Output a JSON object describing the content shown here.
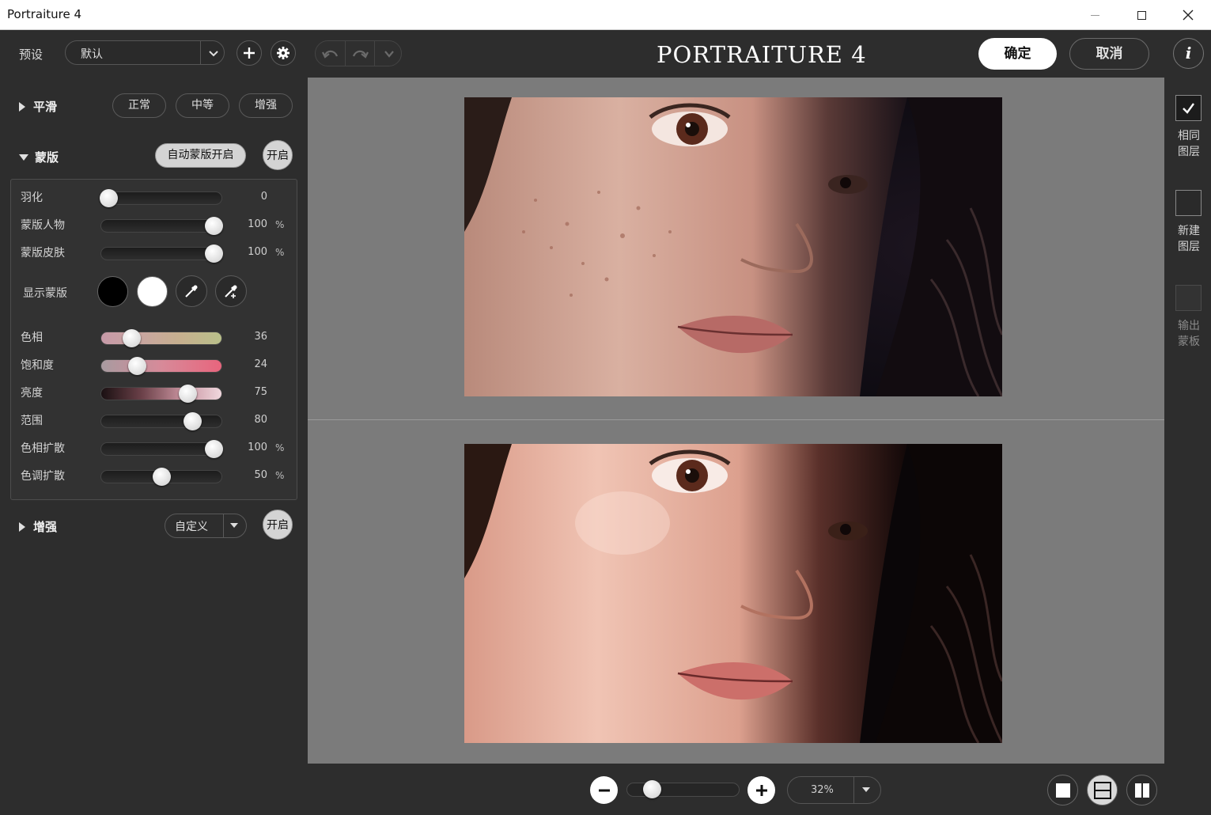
{
  "window": {
    "title": "Portraiture 4"
  },
  "toolbar": {
    "preset_label": "预设",
    "preset_value": "默认",
    "logo": "PORTRAITURE 4",
    "ok_label": "确定",
    "cancel_label": "取消",
    "info_label": "i"
  },
  "smoothing": {
    "label": "平滑",
    "presets": [
      "正常",
      "中等",
      "增强"
    ]
  },
  "mask": {
    "label": "蒙版",
    "auto_label": "自动蒙版开启",
    "toggle_label": "开启",
    "show_mask_label": "显示蒙版",
    "sliders": [
      {
        "label": "羽化",
        "value": "0",
        "unit": "",
        "level": 0.0,
        "track": "dark"
      },
      {
        "label": "蒙版人物",
        "value": "100",
        "unit": "%",
        "level": 1.0,
        "track": "dark"
      },
      {
        "label": "蒙版皮肤",
        "value": "100",
        "unit": "%",
        "level": 1.0,
        "track": "dark"
      },
      {
        "label": "色相",
        "value": "36",
        "unit": "",
        "level": 0.22,
        "track": "hue"
      },
      {
        "label": "饱和度",
        "value": "24",
        "unit": "",
        "level": 0.27,
        "track": "sat"
      },
      {
        "label": "亮度",
        "value": "75",
        "unit": "",
        "level": 0.75,
        "track": "lum"
      },
      {
        "label": "范围",
        "value": "80",
        "unit": "",
        "level": 0.8,
        "track": "dark"
      },
      {
        "label": "色相扩散",
        "value": "100",
        "unit": "%",
        "level": 1.0,
        "track": "dark"
      },
      {
        "label": "色调扩散",
        "value": "50",
        "unit": "%",
        "level": 0.5,
        "track": "dark"
      }
    ]
  },
  "enhance": {
    "label": "增强",
    "select_value": "自定义",
    "toggle_label": "开启"
  },
  "zoom": {
    "value": "32%",
    "level": 0.17
  },
  "right_panel": {
    "same_layer": "相同图层",
    "new_layer": "新建图层",
    "output_mask": "输出蒙板"
  },
  "colors": {
    "background": "#2d2d2d",
    "preview_bg": "#7b7b7b",
    "accent_white": "#ffffff"
  }
}
